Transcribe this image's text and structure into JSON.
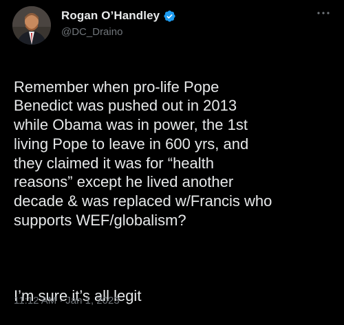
{
  "author": {
    "display_name": "Rogan O’Handley",
    "handle": "@DC_Draino",
    "verified": true,
    "avatar_icon": "avatar-photo"
  },
  "tweet": {
    "paragraph_1": "Remember when pro-life Pope\nBenedict was pushed out in 2013\nwhile Obama was in power, the 1st\nliving Pope to leave in 600 yrs, and\nthey claimed it was for “health\nreasons” except he lived another\ndecade & was replaced w/Francis who\nsupports WEF/globalism?",
    "paragraph_2": "I’m sure it’s all legit"
  },
  "meta": {
    "time": "11:12 AM",
    "separator": "·",
    "date": "Jan 1, 2023"
  },
  "colors": {
    "background": "#000000",
    "text_primary": "#e7e9ea",
    "text_secondary": "#71767b",
    "verified_badge": "#1d9bf0"
  },
  "icons": {
    "verified": "verified-badge-icon",
    "more": "more-options-icon"
  }
}
